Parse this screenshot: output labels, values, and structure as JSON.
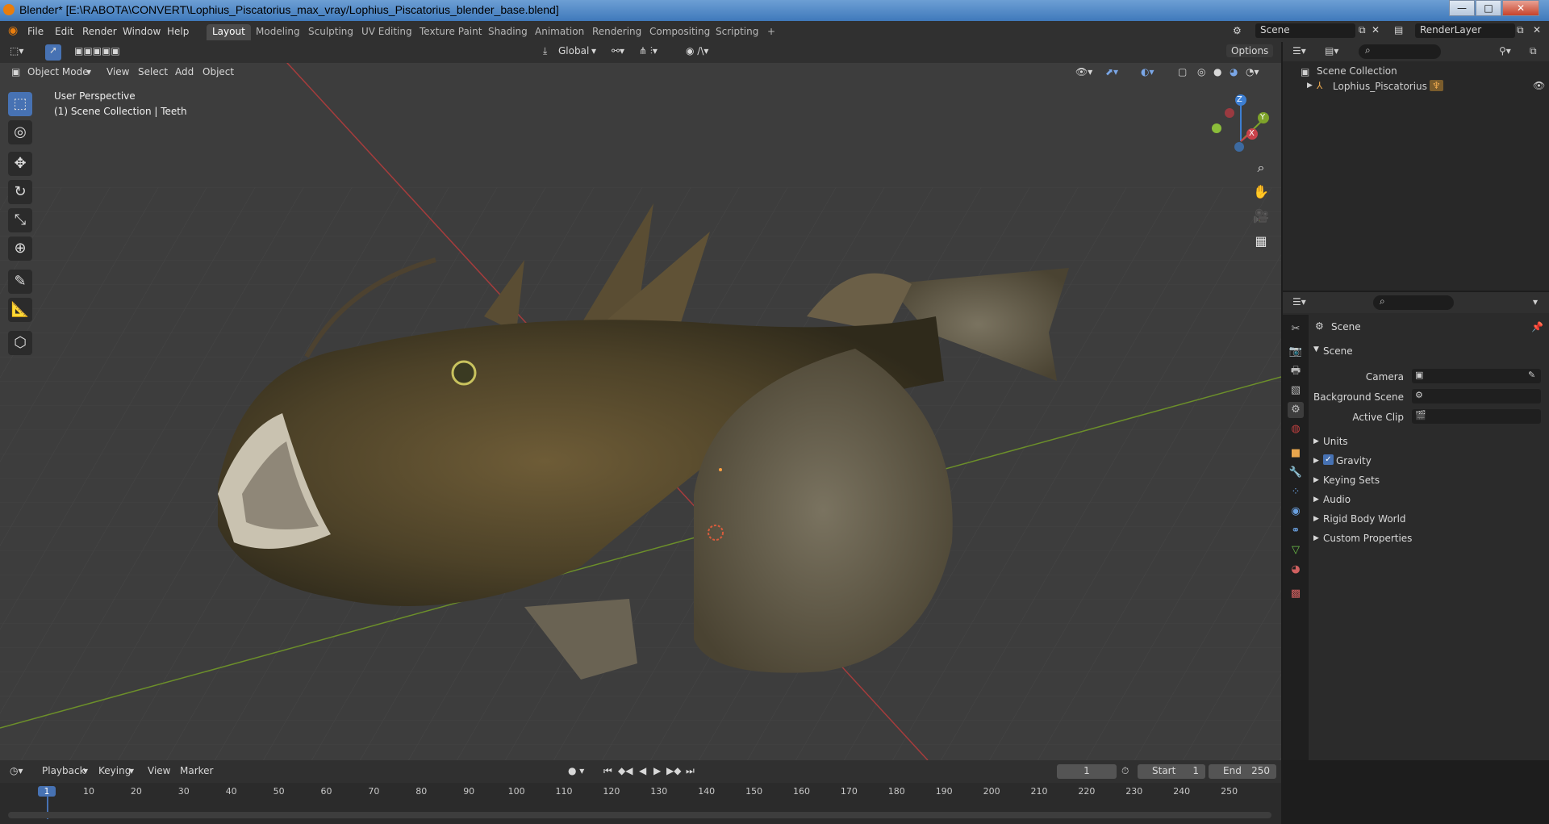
{
  "window": {
    "title": "Blender* [E:\\RABOTA\\CONVERT\\Lophius_Piscatorius_max_vray/Lophius_Piscatorius_blender_base.blend]",
    "minimize": "—",
    "maximize": "□",
    "close": "✕"
  },
  "menu": [
    "File",
    "Edit",
    "Render",
    "Window",
    "Help"
  ],
  "workspaces": [
    "Layout",
    "Modeling",
    "Sculpting",
    "UV Editing",
    "Texture Paint",
    "Shading",
    "Animation",
    "Rendering",
    "Compositing",
    "Scripting",
    "+"
  ],
  "active_workspace": "Layout",
  "scene_selector": {
    "label": "Scene"
  },
  "view_layer": {
    "label": "RenderLayer"
  },
  "viewport": {
    "transform_orientation": "Global",
    "options_label": "Options",
    "mode": "Object Mode",
    "menus": [
      "View",
      "Select",
      "Add",
      "Object"
    ],
    "overlay_text_1": "User Perspective",
    "overlay_text_2": "(1) Scene Collection | Teeth",
    "gizmo_axes": {
      "x": "X",
      "y": "Y",
      "z": "Z"
    }
  },
  "outliner": {
    "root": "Scene Collection",
    "items": [
      "Lophius_Piscatorius"
    ]
  },
  "properties": {
    "header": "Scene",
    "section": "Scene",
    "fields": [
      {
        "label": "Camera"
      },
      {
        "label": "Background Scene"
      },
      {
        "label": "Active Clip"
      }
    ],
    "panels": [
      "Units",
      "Gravity",
      "Keying Sets",
      "Audio",
      "Rigid Body World",
      "Custom Properties"
    ],
    "gravity_checked": true
  },
  "timeline": {
    "menus": [
      "Playback",
      "Keying",
      "View",
      "Marker"
    ],
    "current_frame": "1",
    "start_label": "Start",
    "start": "1",
    "end_label": "End",
    "end": "250",
    "ticks": [
      "1",
      "10",
      "20",
      "30",
      "40",
      "50",
      "60",
      "70",
      "80",
      "90",
      "100",
      "110",
      "120",
      "130",
      "140",
      "150",
      "160",
      "170",
      "180",
      "190",
      "200",
      "210",
      "220",
      "230",
      "240",
      "250"
    ]
  },
  "colors": {
    "accent": "#4772b3",
    "x_axis": "#c9434b",
    "y_axis": "#7ea32a",
    "z_axis": "#3d7fd3"
  }
}
